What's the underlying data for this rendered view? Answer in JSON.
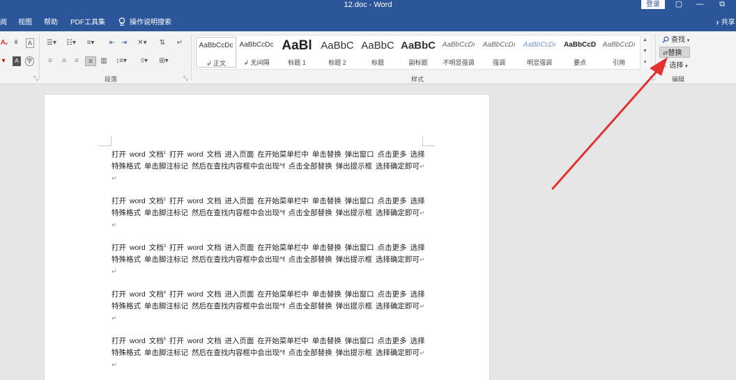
{
  "title_bar": {
    "title": "12.doc  -  Word",
    "login_label": "登录",
    "restore_glyph": "▢",
    "minimize_glyph": "—",
    "extra_glyph": "⧉"
  },
  "menu": {
    "items": [
      "阅",
      "视图",
      "帮助",
      "PDF工具集"
    ],
    "tell_me": "操作说明搜索",
    "share": "共享"
  },
  "ribbon": {
    "paragraph_group_label": "段落",
    "styles_group_label": "样式",
    "editing_group_label": "编辑",
    "styles": [
      {
        "preview": "AaBbCcDc",
        "name": "正文",
        "prefix": "↲ "
      },
      {
        "preview": "AaBbCcDc",
        "name": "无间隔",
        "prefix": "↲ "
      },
      {
        "preview": "AaBl",
        "name": "标题 1",
        "prefix": ""
      },
      {
        "preview": "AaBbC",
        "name": "标题 2",
        "prefix": ""
      },
      {
        "preview": "AaBbC",
        "name": "标题",
        "prefix": ""
      },
      {
        "preview": "AaBbC",
        "name": "副标题",
        "prefix": ""
      },
      {
        "preview": "AaBbCcDı",
        "name": "不明显强调",
        "prefix": ""
      },
      {
        "preview": "AaBbCcDı",
        "name": "强调",
        "prefix": ""
      },
      {
        "preview": "AaBbCcDı",
        "name": "明显强调",
        "prefix": ""
      },
      {
        "preview": "AaBbCcD",
        "name": "要点",
        "prefix": ""
      },
      {
        "preview": "AaBbCcDı",
        "name": "引用",
        "prefix": ""
      }
    ],
    "editing": {
      "find": "查找",
      "replace": "替换",
      "select": "选择"
    }
  },
  "document": {
    "paragraphs": [
      {
        "lead": "打开 word 文档",
        "note": "1",
        "body": "  打开 word 文档   进入页面   在开始菜单栏中   单击替换   弹出窗口   点击更多   选择特殊格式   单击脚注标记   然后在查找内容框中会出现^f   点击全部替换   弹出提示框   选择确定即可"
      },
      {
        "lead": "打开 word 文档",
        "note": "2",
        "body": "  打开 word 文档   进入页面   在开始菜单栏中   单击替换   弹出窗口   点击更多   选择特殊格式   单击脚注标记   然后在查找内容框中会出现^f   点击全部替换   弹出提示框   选择确定即可"
      },
      {
        "lead": "打开 word 文档",
        "note": "3",
        "body": "  打开 word 文档   进入页面   在开始菜单栏中   单击替换   弹出窗口   点击更多   选择特殊格式   单击脚注标记   然后在查找内容框中会出现^f   点击全部替换   弹出提示框   选择确定即可"
      },
      {
        "lead": "打开 word 文档",
        "note": "4",
        "body": "  打开 word 文档   进入页面   在开始菜单栏中   单击替换   弹出窗口   点击更多   选择特殊格式   单击脚注标记   然后在查找内容框中会出现^f   点击全部替换   弹出提示框   选择确定即可"
      },
      {
        "lead": "打开 word 文档",
        "note": "5",
        "body": "  打开 word 文档   进入页面   在开始菜单栏中   单击替换   弹出窗口   点击更多   选择特殊格式   单击脚注标记   然后在查找内容框中会出现^f   点击全部替换   弹出提示框   选择确定即可"
      }
    ],
    "paragraph_mark": "↵"
  },
  "colors": {
    "accent": "#2b579a",
    "annotation_arrow": "#e53030"
  }
}
